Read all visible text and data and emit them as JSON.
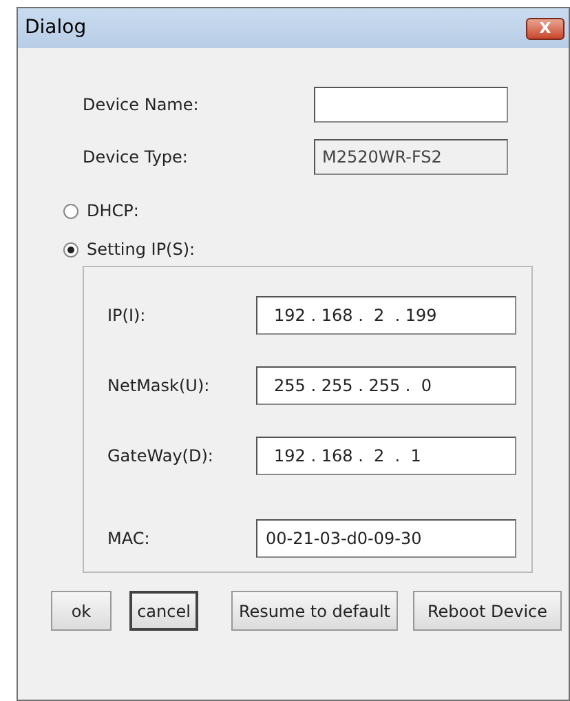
{
  "window": {
    "title": "Dialog",
    "close": "X"
  },
  "device_name": {
    "label": "Device Name:"
  },
  "device_type": {
    "label": "Device Type:",
    "value": "M2520WR-FS2",
    "disabled": true
  },
  "modes": [
    {
      "label": "DHCP:",
      "selected": false
    },
    {
      "label": "Setting IP(S):",
      "selected": true
    }
  ],
  "ip_fields": [
    {
      "label": "IP(I):",
      "value": "192 . 168 .  2  . 199"
    },
    {
      "label": "NetMask(U):",
      "value": "255 . 255 . 255 .  0"
    },
    {
      "label": "GateWay(D):",
      "value": "192 . 168 .  2  .  1"
    },
    {
      "label": "MAC:",
      "value": "00-21-03-d0-09-30"
    }
  ],
  "buttons": [
    {
      "label": "ok",
      "focused": false
    },
    {
      "label": "cancel",
      "focused": true
    },
    {
      "label": "Resume to default",
      "focused": false
    },
    {
      "label": "Reboot Device",
      "focused": false
    }
  ]
}
